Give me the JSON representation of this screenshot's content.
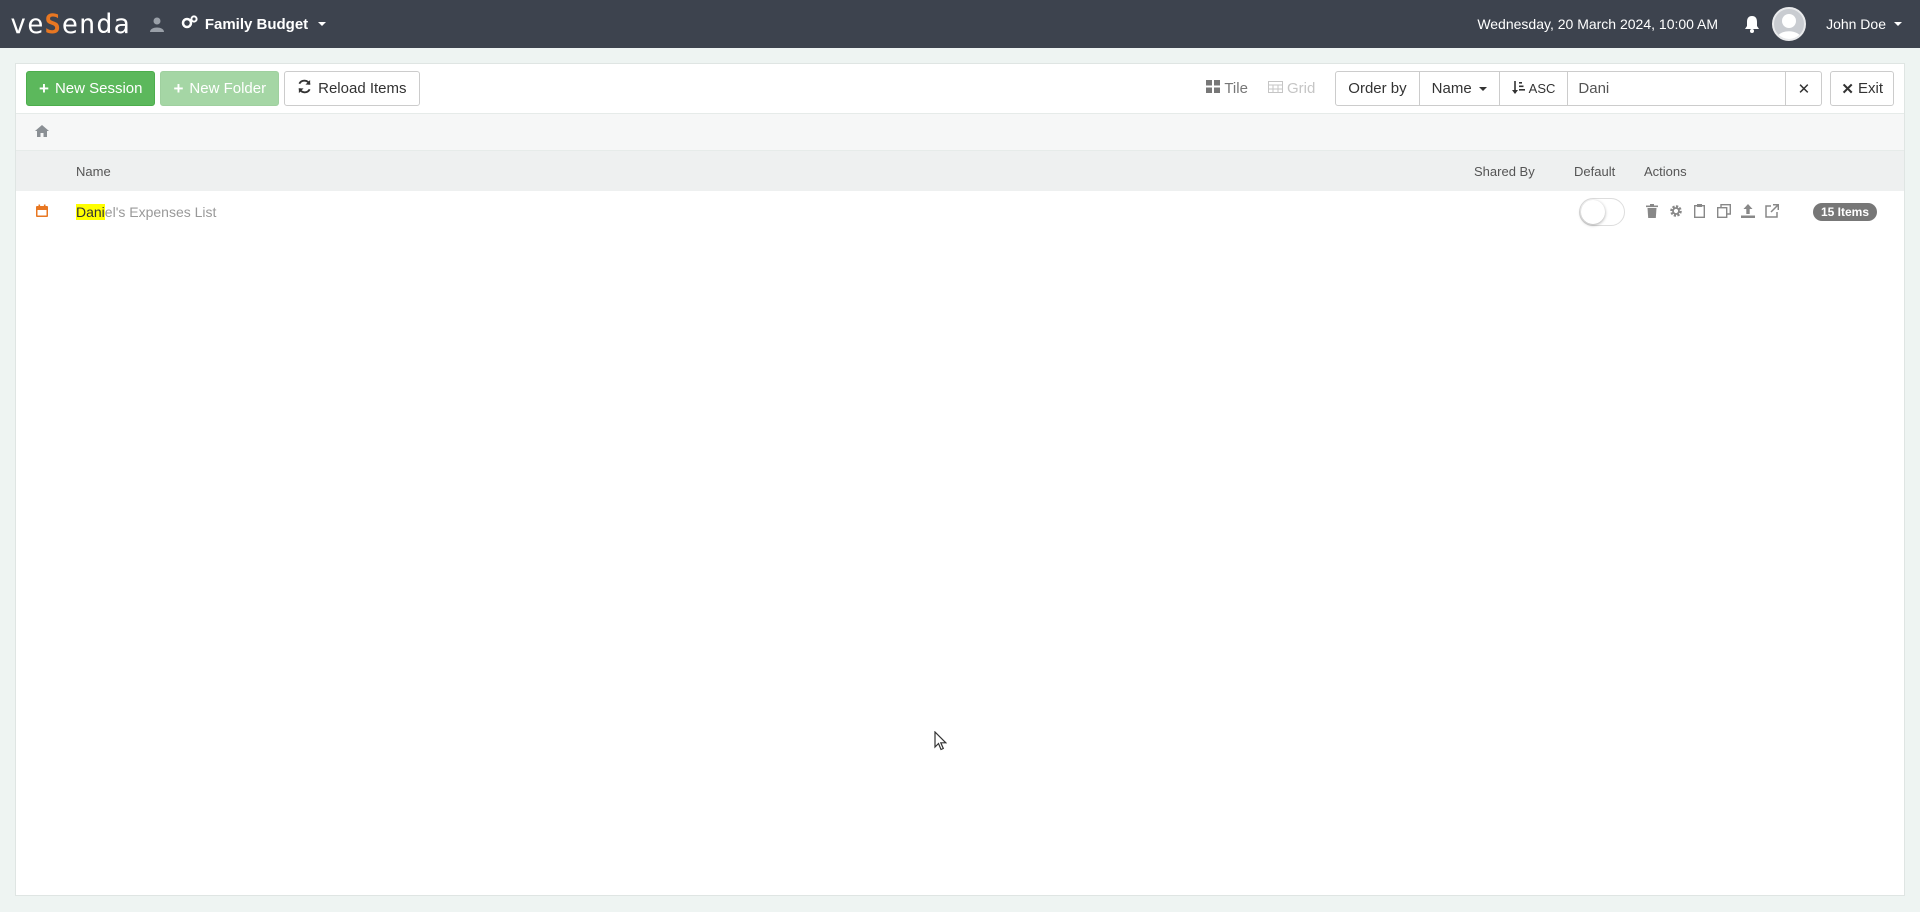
{
  "navbar": {
    "logo_pre": "ve",
    "logo_mid": "S",
    "logo_post": "enda",
    "project": "Family Budget",
    "date": "Wednesday, 20 March 2024, 10:00 AM",
    "username": "John Doe"
  },
  "toolbar": {
    "new_session": "New Session",
    "new_folder": "New Folder",
    "reload_items": "Reload Items",
    "tile": "Tile",
    "grid": "Grid",
    "order_by": "Order by",
    "order_field": "Name",
    "order_dir": "ASC",
    "search_value": "Dani",
    "exit": "Exit"
  },
  "table": {
    "headers": {
      "name": "Name",
      "shared_by": "Shared By",
      "default": "Default",
      "actions": "Actions"
    },
    "rows": [
      {
        "name_highlight": "Dani",
        "name_rest": "el's Expenses List",
        "shared_by": "",
        "default": false,
        "items_badge": "15 Items"
      }
    ]
  },
  "colors": {
    "navbar_bg": "#3d434e",
    "accent": "#e87722",
    "success": "#5cb85c"
  }
}
